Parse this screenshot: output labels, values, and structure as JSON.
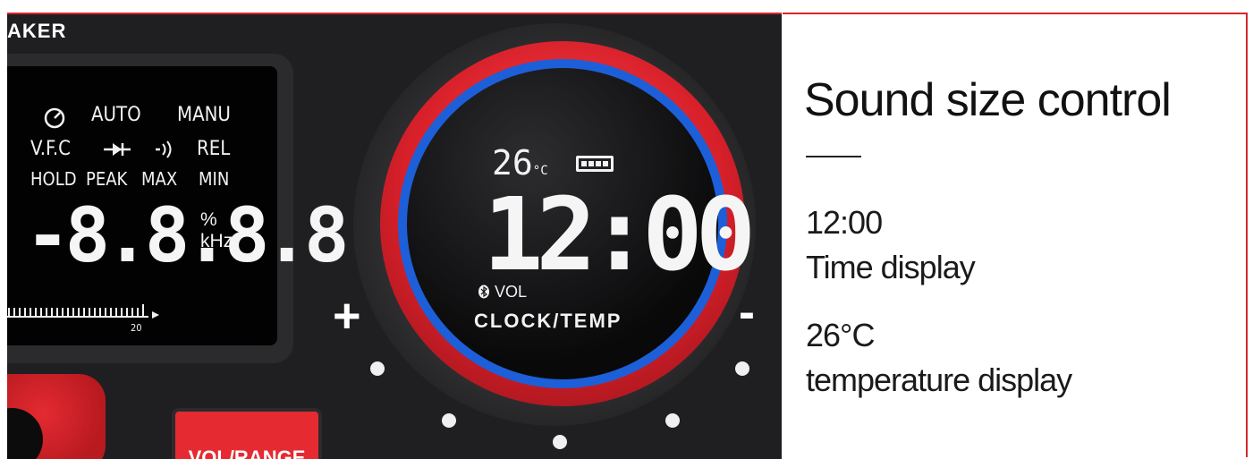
{
  "brand": "AKER",
  "lcd": {
    "row1": [
      "AUTO",
      "MANU"
    ],
    "row2": [
      "V.F.C",
      "REL"
    ],
    "row3": [
      "HOLD",
      "PEAK",
      "MAX",
      "MIN"
    ],
    "digits": "-8.8.8.8",
    "unit_percent": "%",
    "unit_khz": "kHz",
    "scale_label": "20"
  },
  "dial": {
    "temperature": "26",
    "temp_unit": "°C",
    "time": "12:00",
    "vol_label": "VOL",
    "mode_label": "CLOCK/TEMP",
    "plus": "+",
    "minus": "-"
  },
  "button": {
    "label": "VOL/RANGE"
  },
  "panel": {
    "title": "Sound size control",
    "time_value": "12:00",
    "time_caption": "Time display",
    "temp_value": "26°C",
    "temp_caption": "temperature display"
  },
  "colors": {
    "accent_red": "#d7262b",
    "ring_blue": "#1d5fd8",
    "device_body": "#1f1f21"
  }
}
